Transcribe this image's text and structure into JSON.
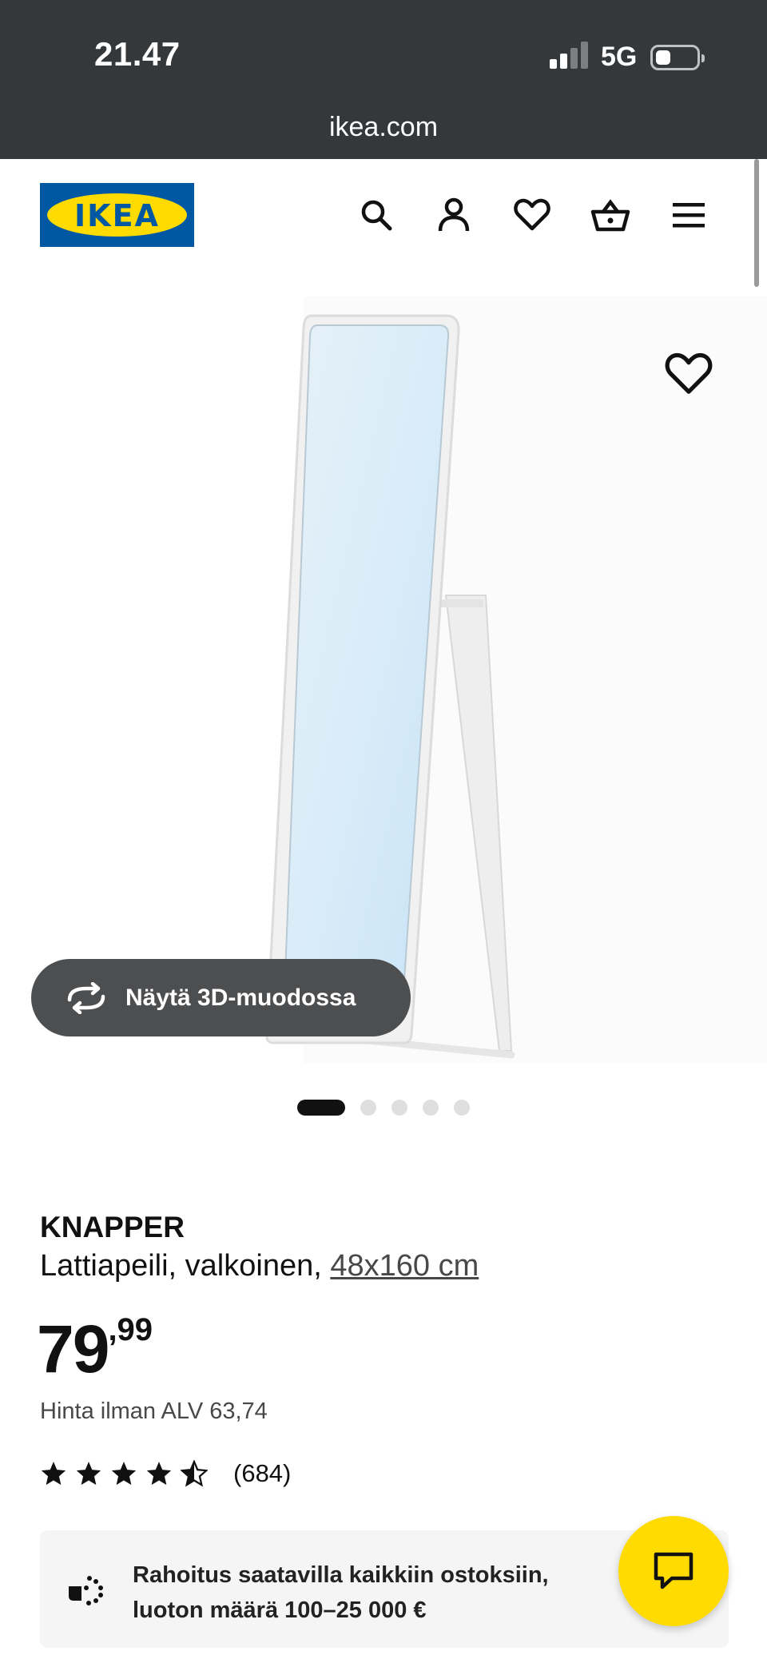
{
  "status_bar": {
    "time": "21.47",
    "network": "5G",
    "url": "ikea.com"
  },
  "header": {
    "logo_text": "IKEA",
    "icons": [
      "search-icon",
      "user-icon",
      "heart-icon",
      "basket-icon",
      "menu-icon"
    ]
  },
  "gallery": {
    "view_3d_label": "Näytä 3D-muodossa",
    "image_count": 5,
    "active_index": 0
  },
  "product": {
    "name": "KNAPPER",
    "description": "Lattiapeili, valkoinen, ",
    "size": "48x160 cm",
    "price_int": "79",
    "price_dec": ",99",
    "vat_text": "Hinta ilman ALV 63,74",
    "rating": 4.5,
    "rating_count": "(684)"
  },
  "financing": {
    "text": "Rahoitus saatavilla kaikkiin ostoksiin, luoton määrä 100–25 000 €"
  },
  "colors": {
    "ikea_blue": "#0058a3",
    "ikea_yellow": "#ffdb00",
    "status_bar": "#35383b"
  }
}
